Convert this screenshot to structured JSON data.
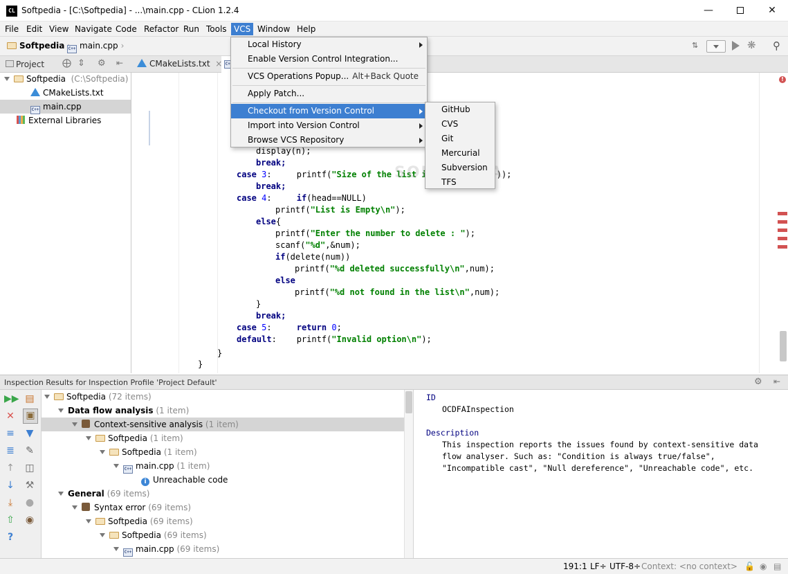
{
  "window": {
    "app_icon": "CL",
    "title": "Softpedia - [C:\\Softpedia] - ...\\main.cpp - CLion 1.2.4",
    "minimize_icon": "minimize-icon",
    "maximize_icon": "maximize-icon",
    "close_icon": "close-icon"
  },
  "menubar": {
    "items": [
      "File",
      "Edit",
      "View",
      "Navigate",
      "Code",
      "Refactor",
      "Run",
      "Tools",
      "VCS",
      "Window",
      "Help"
    ],
    "active": "VCS"
  },
  "navbar": {
    "crumbs": [
      "Softpedia",
      "main.cpp"
    ]
  },
  "project_panel": {
    "header": "Project",
    "tree": [
      {
        "label": "Softpedia",
        "hint": "(C:\\Softpedia)"
      },
      {
        "label": "CMakeLists.txt"
      },
      {
        "label": "main.cpp"
      },
      {
        "label": "External Libraries"
      }
    ]
  },
  "editor": {
    "tabs": [
      "CMakeLists.txt",
      "main.cpp"
    ],
    "lines": [
      {
        "text": "display(n);"
      },
      {
        "text": "break;"
      },
      {
        "text": "case 3:     printf(\"Size of the list is %d\\n\",count());"
      },
      {
        "text": "break;"
      },
      {
        "text": "case 4:     if(head==NULL)"
      },
      {
        "text": "printf(\"List is Empty\\n\");"
      },
      {
        "text": "else{"
      },
      {
        "text": "printf(\"Enter the number to delete : \");"
      },
      {
        "text": "scanf(\"%d\",&num);"
      },
      {
        "text": "if(delete(num))"
      },
      {
        "text": "printf(\"%d deleted successfully\\n\",num);"
      },
      {
        "text": "else"
      },
      {
        "text": "printf(\"%d not found in the list\\n\",num);"
      },
      {
        "text": "}"
      },
      {
        "text": "break;"
      },
      {
        "text": "case 5:     return 0;"
      },
      {
        "text": "default:    printf(\"Invalid option\\n\");"
      },
      {
        "text": "}"
      },
      {
        "text": "}"
      }
    ]
  },
  "vcs_menu": {
    "items": [
      {
        "label": "Local History",
        "submenu": true
      },
      {
        "label": "Enable Version Control Integration..."
      },
      {
        "label": "VCS Operations Popup...",
        "shortcut": "Alt+Back Quote"
      },
      {
        "label": "Apply Patch..."
      },
      {
        "label": "Checkout from Version Control",
        "submenu": true,
        "highlighted": true
      },
      {
        "label": "Import into Version Control",
        "submenu": true
      },
      {
        "label": "Browse VCS Repository",
        "submenu": true
      }
    ],
    "checkout_submenu": [
      "GitHub",
      "CVS",
      "Git",
      "Mercurial",
      "Subversion",
      "TFS"
    ]
  },
  "inspection": {
    "title": "Inspection Results for Inspection Profile 'Project Default'",
    "tree": [
      {
        "label": "Softpedia",
        "count": "(72 items)"
      },
      {
        "label": "Data flow analysis",
        "count": "(1 item)"
      },
      {
        "label": "Context-sensitive analysis",
        "count": "(1 item)"
      },
      {
        "label": "Softpedia",
        "count": "(1 item)"
      },
      {
        "label": "Softpedia",
        "count": "(1 item)"
      },
      {
        "label": "main.cpp",
        "count": "(1 item)"
      },
      {
        "label": "Unreachable code",
        "count": ""
      },
      {
        "label": "General",
        "count": "(69 items)"
      },
      {
        "label": "Syntax error",
        "count": "(69 items)"
      },
      {
        "label": "Softpedia",
        "count": "(69 items)"
      },
      {
        "label": "Softpedia",
        "count": "(69 items)"
      },
      {
        "label": "main.cpp",
        "count": "(69 items)"
      }
    ],
    "detail": {
      "id_heading": "ID",
      "id_value": "OCDFAInspection",
      "desc_heading": "Description",
      "desc_lines": [
        "This inspection reports the issues found by context-sensitive data",
        "flow analyser. Such as: \"Condition is always true/false\",",
        "\"Incompatible cast\", \"Null dereference\", \"Unreachable code\", etc."
      ]
    }
  },
  "statusbar": {
    "position": "191:1",
    "line_sep": "LF÷",
    "encoding": "UTF-8÷",
    "context": "Context: <no context>"
  },
  "watermark": "SOFTPEDIA",
  "colors": {
    "accent": "#3d7fd1",
    "keyword": "#000080",
    "string": "#008000",
    "error_stripe": "#d25252"
  }
}
